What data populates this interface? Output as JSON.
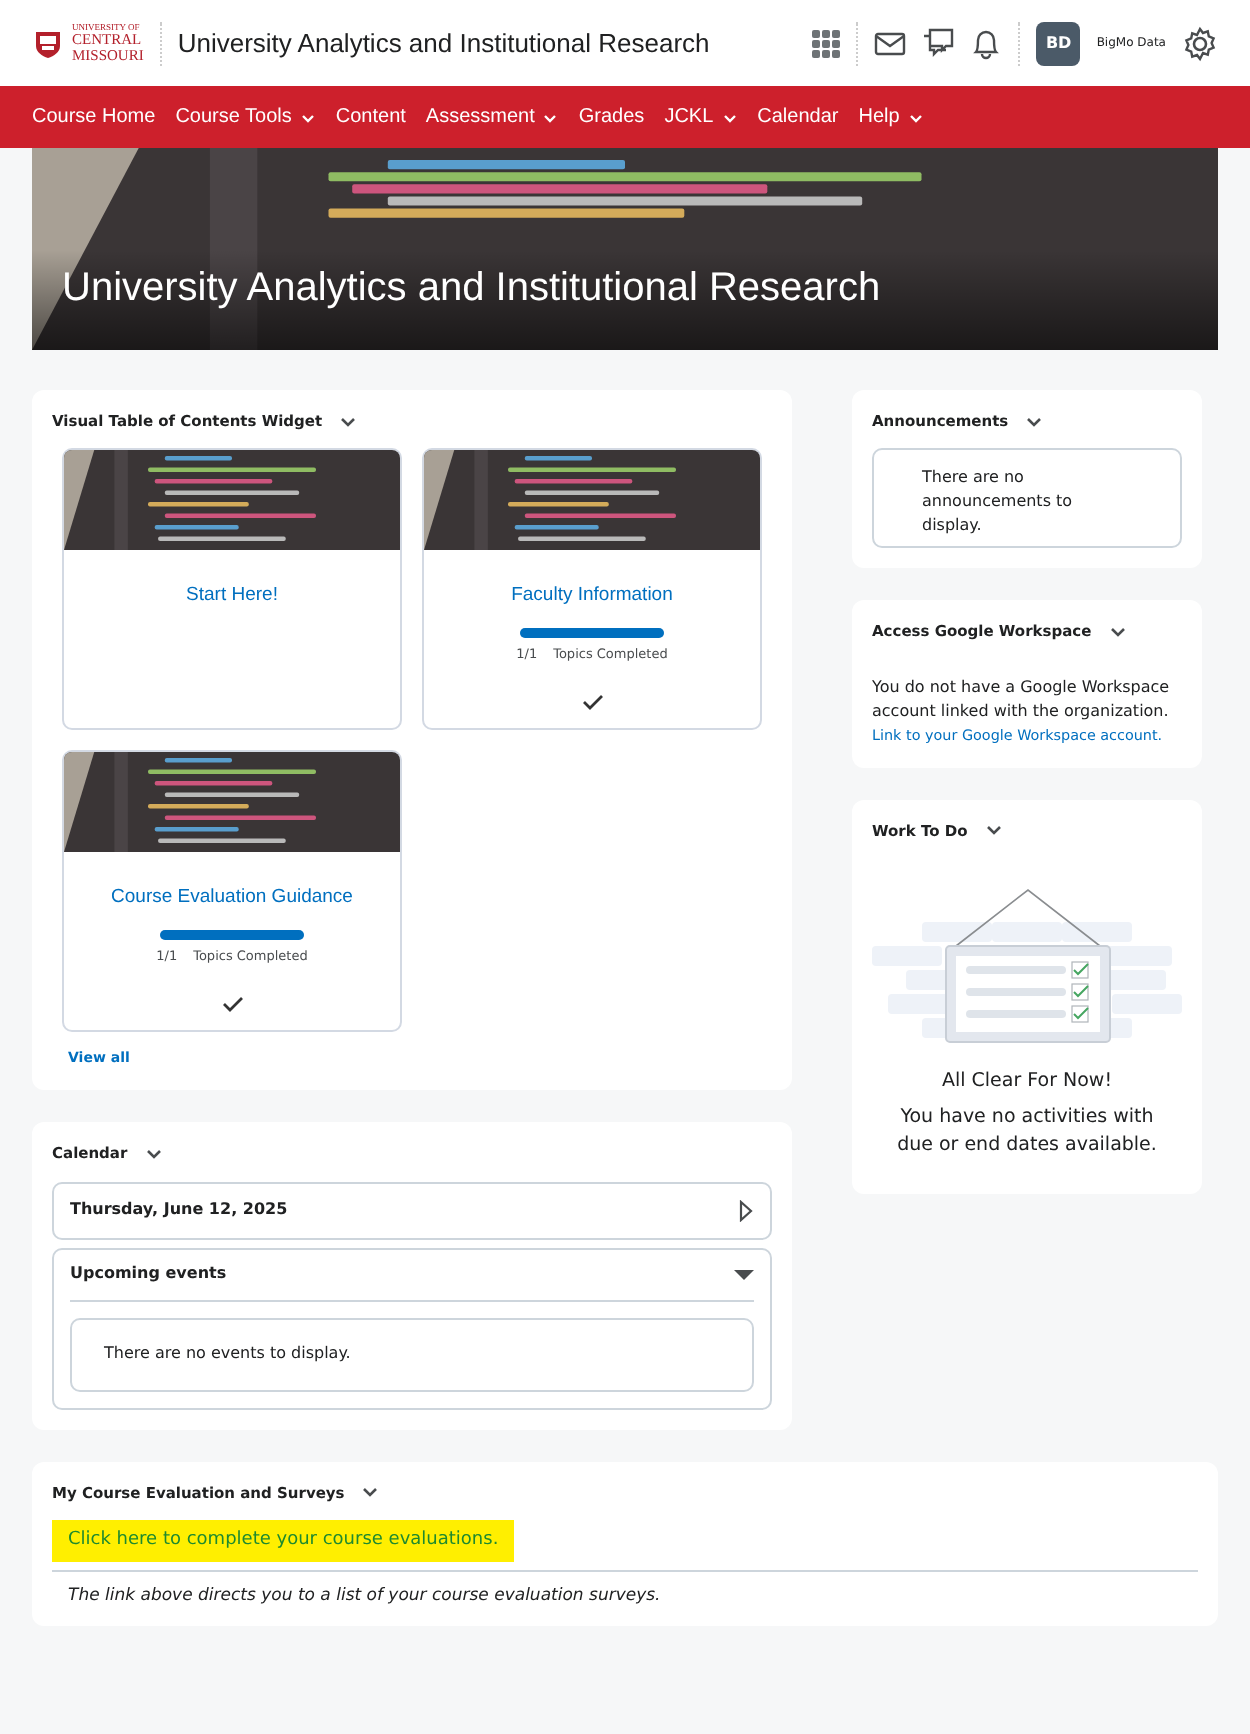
{
  "header": {
    "logo_lines": [
      "UNIVERSITY OF",
      "CENTRAL",
      "MISSOURI"
    ],
    "title": "University Analytics and Institutional Research",
    "user_initials": "BD",
    "user_name": "BigMo Data"
  },
  "nav": [
    {
      "label": "Course Home",
      "dropdown": false
    },
    {
      "label": "Course Tools",
      "dropdown": true
    },
    {
      "label": "Content",
      "dropdown": false
    },
    {
      "label": "Assessment",
      "dropdown": true
    },
    {
      "label": "Grades",
      "dropdown": false
    },
    {
      "label": "JCKL",
      "dropdown": true
    },
    {
      "label": "Calendar",
      "dropdown": false
    },
    {
      "label": "Help",
      "dropdown": true
    }
  ],
  "banner": {
    "title": "University Analytics and Institutional Research"
  },
  "toc": {
    "title": "Visual Table of Contents Widget",
    "modules": [
      {
        "title": "Start Here!",
        "completed": false
      },
      {
        "title": "Faculty Information",
        "progress": {
          "level": 1,
          "count": "1/1",
          "label": "Topics Completed"
        },
        "completed": true
      },
      {
        "title": "Course Evaluation Guidance",
        "progress": {
          "level": 1,
          "count": "1/1",
          "label": "Topics Completed"
        },
        "completed": true
      }
    ],
    "view_all": "View all"
  },
  "calendar": {
    "title": "Calendar",
    "date": "Thursday, June 12, 2025",
    "upcoming": {
      "title": "Upcoming events",
      "expanded": true,
      "message": "There are no events to display."
    }
  },
  "announcements": {
    "title": "Announcements",
    "message": "There are no announcements to display."
  },
  "google": {
    "title": "Access Google Workspace",
    "message": "You do not have a Google Workspace account linked with the organization.",
    "link": "Link to your Google Workspace account."
  },
  "work_to_do": {
    "title": "Work To Do",
    "heading": "All Clear For Now!",
    "message": "You have no activities with due or end dates available."
  },
  "evaluations": {
    "title": "My Course Evaluation and Surveys",
    "link": "Click here to complete your course evaluations.",
    "highlighted": true,
    "note": "The link above directs you to a list of your course evaluation surveys."
  }
}
